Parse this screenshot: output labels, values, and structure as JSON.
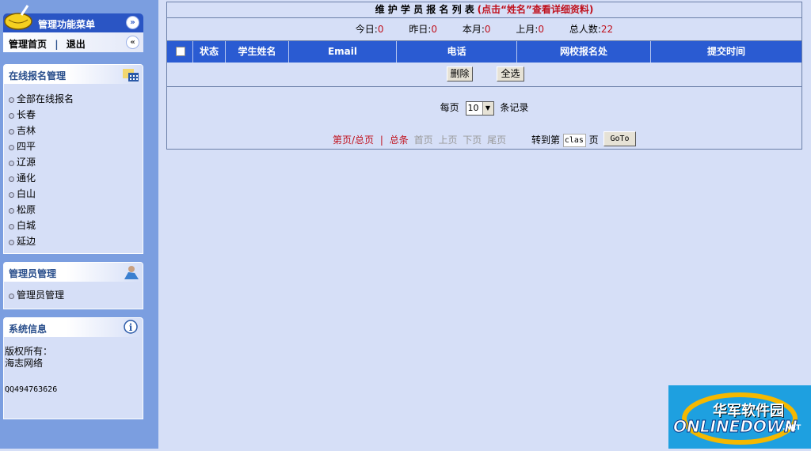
{
  "sidebar": {
    "menu_title": "管理功能菜单",
    "home_link": "管理首页",
    "separator": "|",
    "logout_link": "退出",
    "expand_icon": "double-chevron-down-icon",
    "collapse_icon": "double-chevron-left-icon",
    "panels": [
      {
        "title": "在线报名管理",
        "icon": "calendar-folder-icon",
        "items": [
          "全部在线报名",
          "长春",
          "吉林",
          "四平",
          "辽源",
          "通化",
          "白山",
          "松原",
          "白城",
          "延边"
        ]
      },
      {
        "title": "管理员管理",
        "icon": "admin-user-icon",
        "items": [
          "管理员管理"
        ]
      },
      {
        "title": "系统信息",
        "icon": "info-icon",
        "lines": [
          "版权所有：",
          "海志网络",
          "",
          "QQ494763626"
        ]
      }
    ]
  },
  "main": {
    "title": "维 护 学 员 报 名 列 表",
    "title_hint": "(点击“姓名”查看详细资料)",
    "stats": [
      {
        "label": "今日:",
        "value": "0"
      },
      {
        "label": "昨日:",
        "value": "0"
      },
      {
        "label": "本月:",
        "value": "0"
      },
      {
        "label": "上月:",
        "value": "0"
      },
      {
        "label": "总人数:",
        "value": "22"
      }
    ],
    "columns": [
      "状态",
      "学生姓名",
      "Email",
      "电话",
      "网校报名处",
      "提交时间"
    ],
    "delete_button": "删除",
    "select_all_button": "全选",
    "per_page_label": "每页",
    "per_page_value": "10",
    "per_page_suffix": "条记录",
    "pagination": {
      "page_info": "第页/总页",
      "sep": "|",
      "total": "总条",
      "first": "首页",
      "prev": "上页",
      "next": "下页",
      "last": "尾页"
    },
    "goto_label": "转到第",
    "goto_value": "clas",
    "goto_suffix": "页",
    "goto_button": "GoTo"
  },
  "watermark": {
    "cn": "华军软件园",
    "en": "ONLINEDOWN",
    ".net": ".NET"
  }
}
